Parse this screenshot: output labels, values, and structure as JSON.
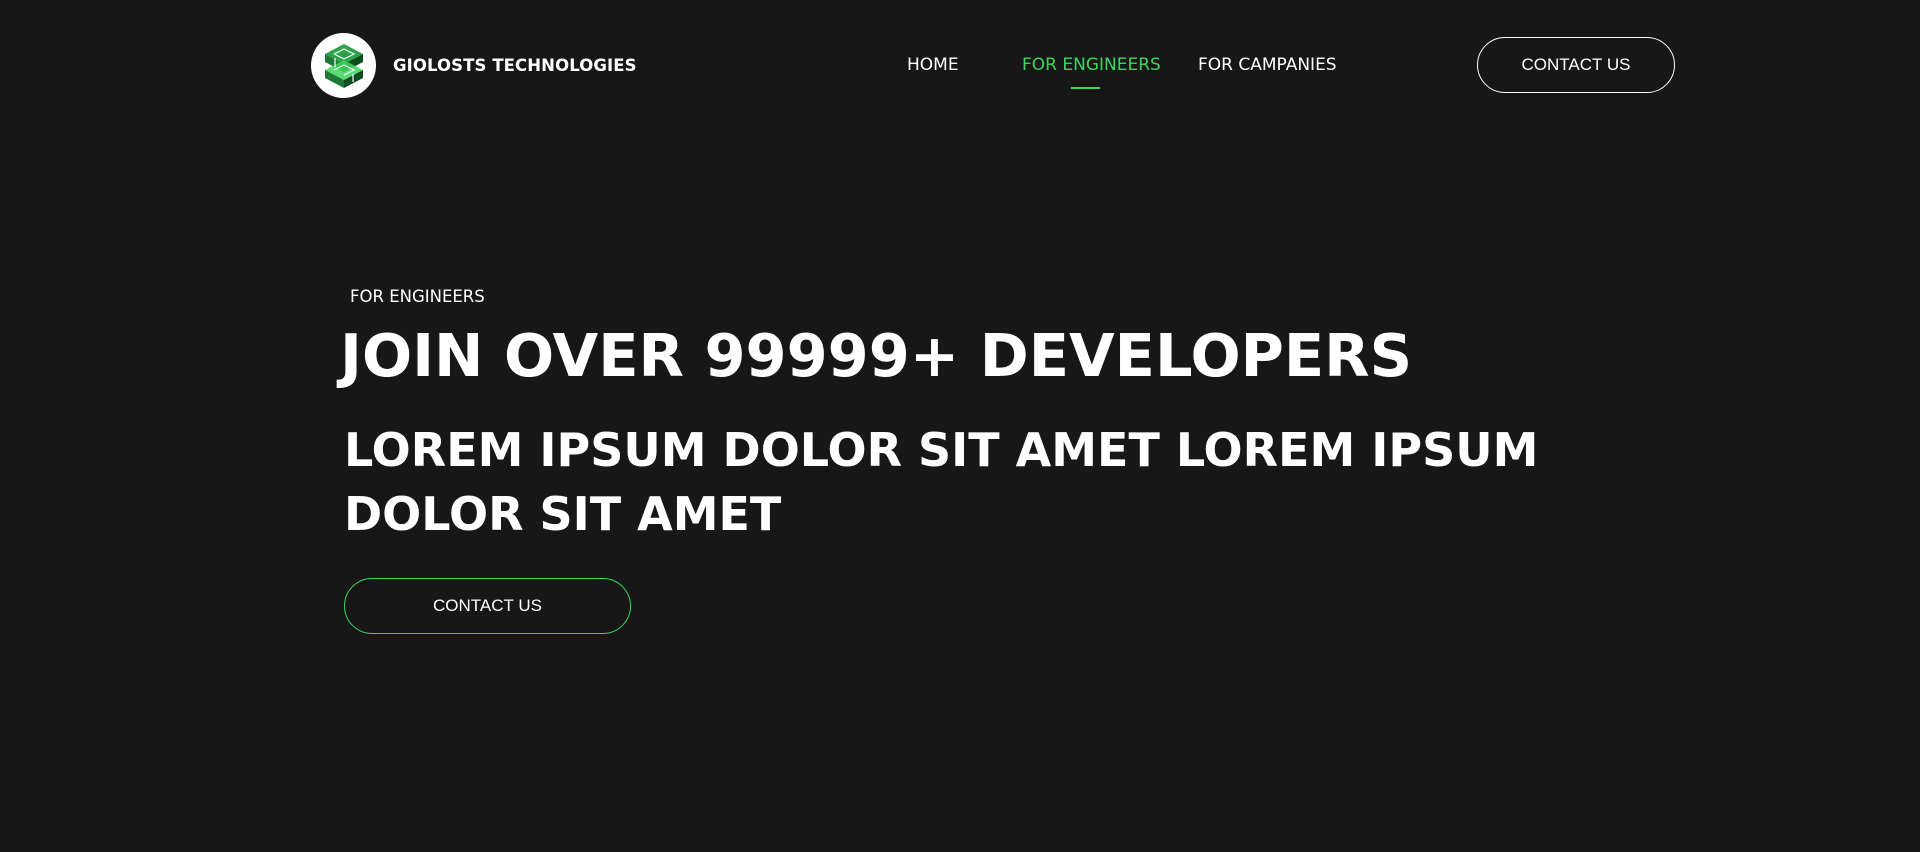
{
  "colors": {
    "background": "#181718",
    "accent": "#3dd65c",
    "text": "#ffffff"
  },
  "header": {
    "logo_icon": "cube-s-logo-icon",
    "brand_name": "GIOLOSTS TECHNOLOGIES",
    "nav": [
      {
        "label": "HOME",
        "active": false
      },
      {
        "label": "FOR ENGINEERS",
        "active": true
      },
      {
        "label": "FOR CAMPANIES",
        "active": false
      }
    ],
    "contact_label": "CONTACT US"
  },
  "hero": {
    "eyebrow": "FOR ENGINEERS",
    "headline": "JOIN OVER 99999+ DEVELOPERS",
    "subhead_line1": "LOREM IPSUM DOLOR SIT AMET  LOREM IPSUM",
    "subhead_line2": "DOLOR SIT AMET",
    "cta_label": "CONTACT US"
  }
}
